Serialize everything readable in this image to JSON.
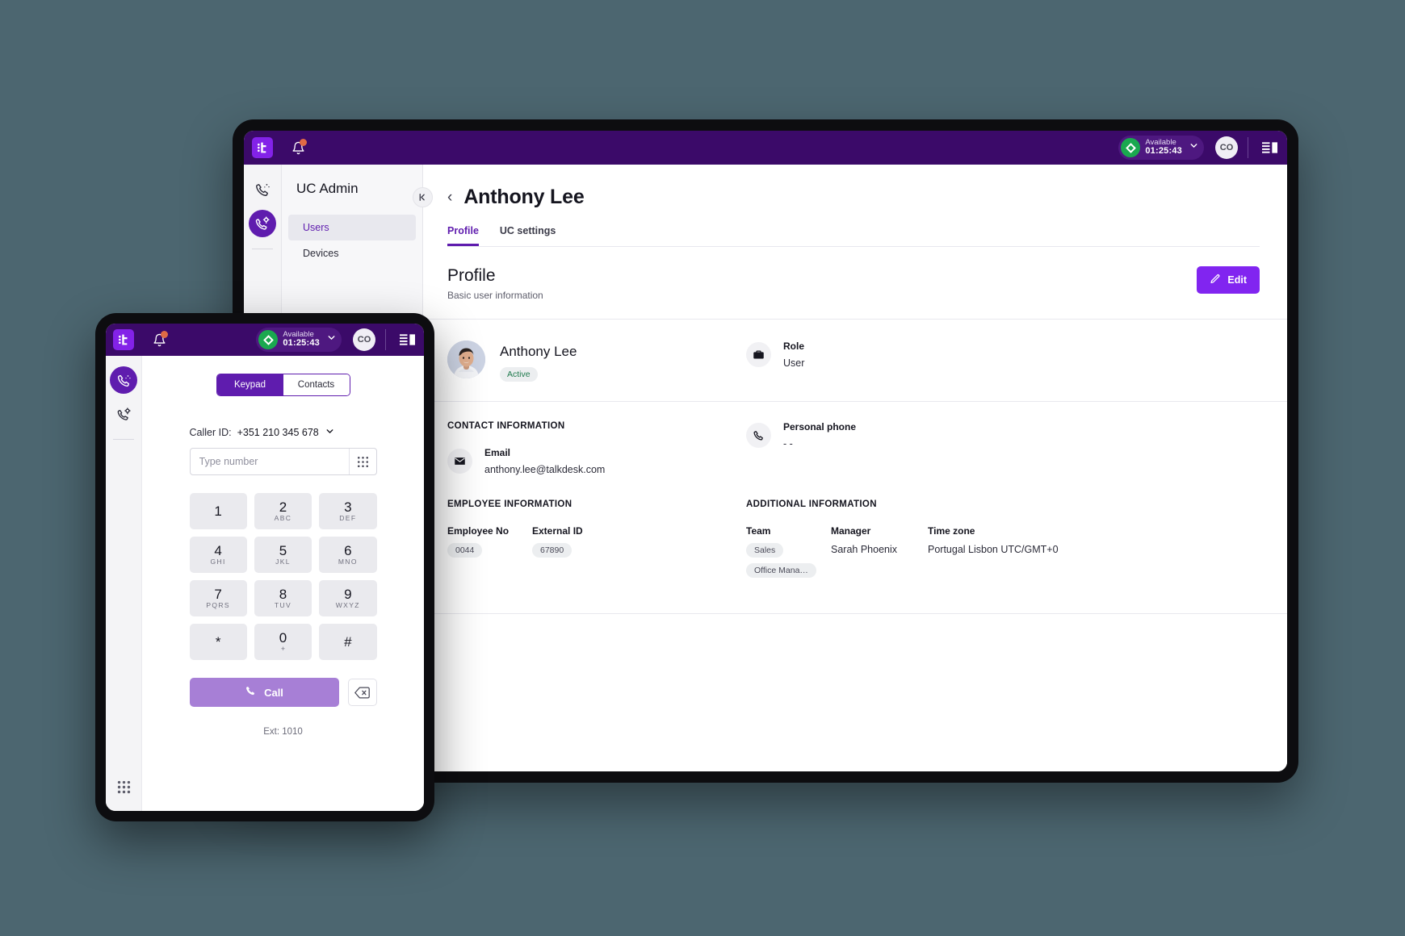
{
  "topbar": {
    "logo_alt": "talkdesk-logo",
    "bell_label": "notifications",
    "status_label": "Available",
    "status_time": "01:25:43",
    "avatar_initials": "CO",
    "panels_label": "panels"
  },
  "rail": {
    "items": [
      {
        "name": "phone-activity-icon",
        "label": "Conversations"
      },
      {
        "name": "phone-admin-icon",
        "label": "UC Admin"
      }
    ]
  },
  "nav": {
    "title": "UC Admin",
    "collapse_label": "❘‹",
    "items": [
      {
        "label": "Users",
        "active": true
      },
      {
        "label": "Devices",
        "active": false
      }
    ]
  },
  "page": {
    "back_label": "‹",
    "title": "Anthony Lee",
    "tabs": [
      {
        "label": "Profile",
        "active": true
      },
      {
        "label": "UC settings",
        "active": false
      }
    ],
    "section_title": "Profile",
    "section_sub": "Basic user information",
    "edit_label": "Edit"
  },
  "identity": {
    "name": "Anthony Lee",
    "status_chip": "Active",
    "role_label": "Role",
    "role_value": "User"
  },
  "contact": {
    "section_label": "CONTACT INFORMATION",
    "email_label": "Email",
    "email_value": "anthony.lee@talkdesk.com",
    "phone_label": "Personal phone",
    "phone_value": "- -"
  },
  "employee": {
    "section_label": "EMPLOYEE INFORMATION",
    "employee_no_label": "Employee No",
    "employee_no_value": "0044",
    "external_id_label": "External ID",
    "external_id_value": "67890"
  },
  "additional": {
    "section_label": "ADDITIONAL INFORMATION",
    "team_label": "Team",
    "team_values": [
      "Sales",
      "Office Mana…"
    ],
    "manager_label": "Manager",
    "manager_value": "Sarah Phoenix",
    "timezone_label": "Time zone",
    "timezone_value": "Portugal Lisbon UTC/GMT+0"
  },
  "phone": {
    "topbar": {
      "status_label": "Available",
      "status_time": "01:25:43",
      "avatar_initials": "CO"
    },
    "tabs": {
      "keypad": "Keypad",
      "contacts": "Contacts"
    },
    "caller_id_label": "Caller ID:",
    "caller_id_value": "+351 210 345 678",
    "input_placeholder": "Type number",
    "input_value": "",
    "keys": [
      {
        "digit": "1",
        "letters": ""
      },
      {
        "digit": "2",
        "letters": "ABC"
      },
      {
        "digit": "3",
        "letters": "DEF"
      },
      {
        "digit": "4",
        "letters": "GHI"
      },
      {
        "digit": "5",
        "letters": "JKL"
      },
      {
        "digit": "6",
        "letters": "MNO"
      },
      {
        "digit": "7",
        "letters": "PQRS"
      },
      {
        "digit": "8",
        "letters": "TUV"
      },
      {
        "digit": "9",
        "letters": "WXYZ"
      },
      {
        "digit": "*",
        "letters": ""
      },
      {
        "digit": "0",
        "letters": "+"
      },
      {
        "digit": "#",
        "letters": ""
      }
    ],
    "call_label": "Call",
    "ext_label": "Ext: 1010"
  },
  "colors": {
    "brand_purple": "#5f1cae",
    "header_purple": "#3b0a69",
    "edit_purple": "#8125f0",
    "call_purple": "#a77fd6",
    "status_green": "#1aa84f",
    "page_bg": "#4c6670"
  }
}
